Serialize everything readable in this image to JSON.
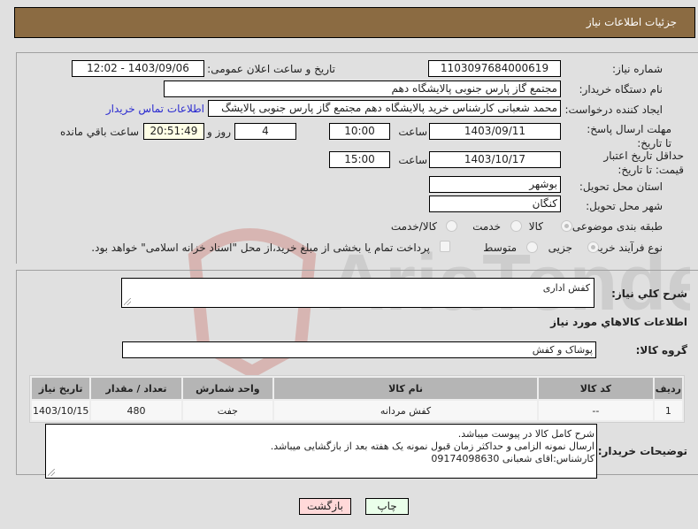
{
  "header": {
    "title": "جزئیات اطلاعات نیاز"
  },
  "colors": {
    "header_bg": "#8b6b42",
    "return_button_bg": "#ffd9d9",
    "print_button_bg": "#eaffea",
    "link": "#2a2ad0"
  },
  "fields": {
    "need_number": {
      "label": "شماره نیاز:",
      "value": "1103097684000619"
    },
    "announce_datetime": {
      "label": "تاریخ و ساعت اعلان عمومی:",
      "value": "1403/09/06 - 12:02"
    },
    "buyer_org": {
      "label": "نام دستگاه خریدار:",
      "value": "مجتمع گاز پارس جنوبی  پالایشگاه دهم"
    },
    "requester": {
      "label": "ایجاد کننده درخواست:",
      "value": "محمد شعبانی کارشناس خرید پالایشگاه دهم  مجتمع گاز پارس جنوبی  پالایشگ",
      "contact_link": "اطلاعات تماس خریدار"
    },
    "reply_deadline": {
      "label": "مهلت ارسال پاسخ: تا تاریخ:",
      "date": "1403/09/11",
      "time_label": "ساعت",
      "time": "10:00",
      "days": "4",
      "days_label": "روز و",
      "remaining": "20:51:49",
      "remaining_label": "ساعت باقي مانده"
    },
    "price_validity": {
      "label": "حداقل تاریخ اعتبار قیمت: تا تاریخ:",
      "date": "1403/10/17",
      "time_label": "ساعت",
      "time": "15:00"
    },
    "province": {
      "label": "استان محل تحویل:",
      "value": "بوشهر"
    },
    "city": {
      "label": "شهر محل تحویل:",
      "value": "کنگان"
    },
    "category": {
      "label": "طبقه بندی موضوعی:",
      "options": [
        "کالا",
        "خدمت",
        "کالا/خدمت"
      ],
      "selected": "کالا"
    },
    "purchase_type": {
      "label": "نوع فرآیند خرید :",
      "options": [
        "جزیی",
        "متوسط"
      ],
      "selected": "جزیی",
      "payment_note": "پرداخت تمام یا بخشی از مبلغ خرید،از محل \"اسناد خزانه اسلامی\" خواهد بود."
    }
  },
  "description": {
    "label": "شرح کلي نياز:",
    "value": "کفش اداری"
  },
  "items_section": {
    "title": "اطلاعات کالاهاي مورد نياز",
    "group_label": "گروه کالا:",
    "group_value": "پوشاک و کفش"
  },
  "table": {
    "headers": [
      "ردیف",
      "کد کالا",
      "نام کالا",
      "واحد شمارش",
      "تعداد / مقدار",
      "تاریخ نیاز"
    ],
    "rows": [
      [
        "1",
        "--",
        "کفش مردانه",
        "جفت",
        "480",
        "1403/10/15"
      ]
    ]
  },
  "buyer_notes": {
    "label": "توضیحات خریدار:",
    "lines": [
      "شرح کامل کالا در پیوست میباشد.",
      "ارسال نمونه الزامی و حداکثر زمان قبول نمونه یک هفته بعد از بازگشایی میباشد.",
      "کارشناس:اقای شعبانی 09174098630"
    ]
  },
  "buttons": {
    "print": "چاپ",
    "back": "بازگشت"
  },
  "watermark": {
    "text": "AriaTender.net"
  }
}
